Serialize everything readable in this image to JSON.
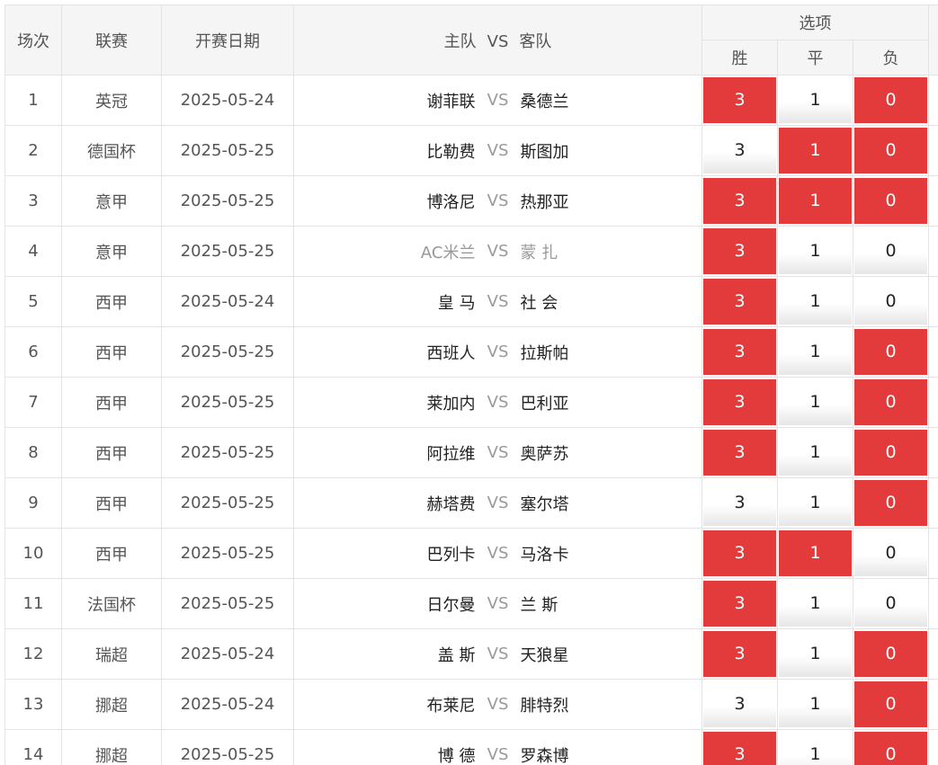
{
  "header": {
    "col_round": "场次",
    "col_league": "联赛",
    "col_date": "开赛日期",
    "col_home": "主队",
    "col_vs": "VS",
    "col_away": "客队",
    "col_options": "选项",
    "opt_win": "胜",
    "opt_draw": "平",
    "opt_lose": "负"
  },
  "matches": [
    {
      "no": "1",
      "league": "英冠",
      "date": "2025-05-24",
      "home": "谢菲联",
      "vs": "VS",
      "away": "桑德兰",
      "w": "3",
      "d": "1",
      "l": "0",
      "sel": [
        true,
        false,
        true
      ]
    },
    {
      "no": "2",
      "league": "德国杯",
      "date": "2025-05-25",
      "home": "比勒费",
      "vs": "VS",
      "away": "斯图加",
      "w": "3",
      "d": "1",
      "l": "0",
      "sel": [
        false,
        true,
        true
      ]
    },
    {
      "no": "3",
      "league": "意甲",
      "date": "2025-05-25",
      "home": "博洛尼",
      "vs": "VS",
      "away": "热那亚",
      "w": "3",
      "d": "1",
      "l": "0",
      "sel": [
        true,
        true,
        true
      ]
    },
    {
      "no": "4",
      "league": "意甲",
      "date": "2025-05-25",
      "home": "AC米兰",
      "vs": "VS",
      "away": "蒙 扎",
      "w": "3",
      "d": "1",
      "l": "0",
      "sel": [
        true,
        false,
        false
      ],
      "faded": true
    },
    {
      "no": "5",
      "league": "西甲",
      "date": "2025-05-24",
      "home": "皇 马",
      "vs": "VS",
      "away": "社 会",
      "w": "3",
      "d": "1",
      "l": "0",
      "sel": [
        true,
        false,
        false
      ]
    },
    {
      "no": "6",
      "league": "西甲",
      "date": "2025-05-25",
      "home": "西班人",
      "vs": "VS",
      "away": "拉斯帕",
      "w": "3",
      "d": "1",
      "l": "0",
      "sel": [
        true,
        false,
        true
      ]
    },
    {
      "no": "7",
      "league": "西甲",
      "date": "2025-05-25",
      "home": "莱加内",
      "vs": "VS",
      "away": "巴利亚",
      "w": "3",
      "d": "1",
      "l": "0",
      "sel": [
        true,
        false,
        true
      ]
    },
    {
      "no": "8",
      "league": "西甲",
      "date": "2025-05-25",
      "home": "阿拉维",
      "vs": "VS",
      "away": "奥萨苏",
      "w": "3",
      "d": "1",
      "l": "0",
      "sel": [
        true,
        false,
        true
      ]
    },
    {
      "no": "9",
      "league": "西甲",
      "date": "2025-05-25",
      "home": "赫塔费",
      "vs": "VS",
      "away": "塞尔塔",
      "w": "3",
      "d": "1",
      "l": "0",
      "sel": [
        false,
        false,
        true
      ]
    },
    {
      "no": "10",
      "league": "西甲",
      "date": "2025-05-25",
      "home": "巴列卡",
      "vs": "VS",
      "away": "马洛卡",
      "w": "3",
      "d": "1",
      "l": "0",
      "sel": [
        true,
        true,
        false
      ]
    },
    {
      "no": "11",
      "league": "法国杯",
      "date": "2025-05-25",
      "home": "日尔曼",
      "vs": "VS",
      "away": "兰 斯",
      "w": "3",
      "d": "1",
      "l": "0",
      "sel": [
        true,
        false,
        false
      ]
    },
    {
      "no": "12",
      "league": "瑞超",
      "date": "2025-05-24",
      "home": "盖 斯",
      "vs": "VS",
      "away": "天狼星",
      "w": "3",
      "d": "1",
      "l": "0",
      "sel": [
        true,
        false,
        true
      ]
    },
    {
      "no": "13",
      "league": "挪超",
      "date": "2025-05-24",
      "home": "布莱尼",
      "vs": "VS",
      "away": "腓特烈",
      "w": "3",
      "d": "1",
      "l": "0",
      "sel": [
        false,
        false,
        true
      ]
    },
    {
      "no": "14",
      "league": "挪超",
      "date": "2025-05-25",
      "home": "博 德",
      "vs": "VS",
      "away": "罗森博",
      "w": "3",
      "d": "1",
      "l": "0",
      "sel": [
        true,
        false,
        true
      ]
    }
  ],
  "colors": {
    "selected": "#e33b3b",
    "border": "#e3e3e3",
    "header_bg": "#f5f5f5"
  }
}
